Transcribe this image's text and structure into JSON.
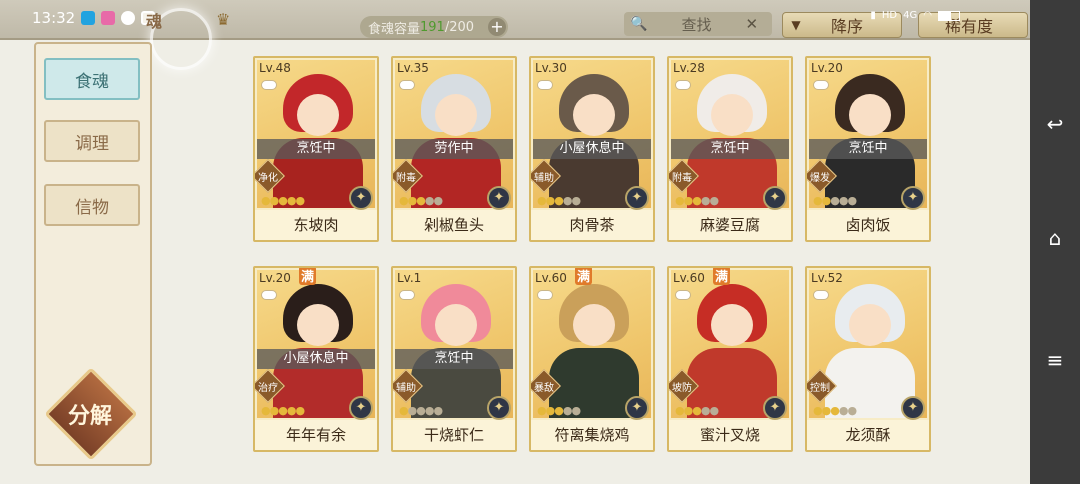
{
  "status_bar": {
    "time": "13:32",
    "network": "4G",
    "hd": "HD"
  },
  "header": {
    "partial_title": "魂",
    "capacity_label": "食魂容量",
    "capacity_count": "191",
    "capacity_max": "/200",
    "search_placeholder": "查找",
    "sort_label": "降序",
    "sort2_label": "稀有度"
  },
  "sidebar": {
    "tabs": [
      {
        "label": "食魂"
      },
      {
        "label": "调理"
      },
      {
        "label": "信物"
      }
    ],
    "decompose_label": "分解"
  },
  "cards": [
    {
      "level": "Lv.48",
      "name": "东坡肉",
      "status": "烹饪中",
      "role": "净化",
      "stars": 5,
      "stars_on": 5,
      "max": false,
      "hair": "#c2272a",
      "body": "#a8231f"
    },
    {
      "level": "Lv.35",
      "name": "剁椒鱼头",
      "status": "劳作中",
      "role": "附毒",
      "stars": 5,
      "stars_on": 3,
      "max": false,
      "hair": "#d7dde2",
      "body": "#b22624"
    },
    {
      "level": "Lv.30",
      "name": "肉骨茶",
      "status": "小屋休息中",
      "role": "辅助",
      "stars": 5,
      "stars_on": 3,
      "max": false,
      "hair": "#6a5a4a",
      "body": "#4a3a30"
    },
    {
      "level": "Lv.28",
      "name": "麻婆豆腐",
      "status": "烹饪中",
      "role": "附毒",
      "stars": 5,
      "stars_on": 3,
      "max": false,
      "hair": "#f0ece8",
      "body": "#c0392b"
    },
    {
      "level": "Lv.20",
      "name": "卤肉饭",
      "status": "烹饪中",
      "role": "爆发",
      "stars": 5,
      "stars_on": 2,
      "max": false,
      "hair": "#3a2a20",
      "body": "#2a2a2a"
    },
    {
      "level": "Lv.20",
      "name": "年年有余",
      "status": "小屋休息中",
      "role": "治疗",
      "stars": 5,
      "stars_on": 5,
      "max": true,
      "hair": "#2a1e1a",
      "body": "#b22c2a"
    },
    {
      "level": "Lv.1",
      "name": "干烧虾仁",
      "status": "烹饪中",
      "role": "辅助",
      "stars": 5,
      "stars_on": 1,
      "max": false,
      "hair": "#f08a9a",
      "body": "#4a4a40"
    },
    {
      "level": "Lv.60",
      "name": "符离集烧鸡",
      "status": "",
      "role": "暴敌",
      "stars": 5,
      "stars_on": 3,
      "max": true,
      "hair": "#caa05a",
      "body": "#2f3a2e"
    },
    {
      "level": "Lv.60",
      "name": "蜜汁叉烧",
      "status": "",
      "role": "坡防",
      "stars": 5,
      "stars_on": 3,
      "max": true,
      "hair": "#c62d25",
      "body": "#c0392b"
    },
    {
      "level": "Lv.52",
      "name": "龙须酥",
      "status": "",
      "role": "控制",
      "stars": 5,
      "stars_on": 3,
      "max": false,
      "hair": "#e8ecef",
      "body": "#f3f2ee"
    }
  ],
  "colors": {
    "accent_teal": "#83bfc2",
    "gold": "#d7b865",
    "status_overlay": "#5a5a5a"
  }
}
